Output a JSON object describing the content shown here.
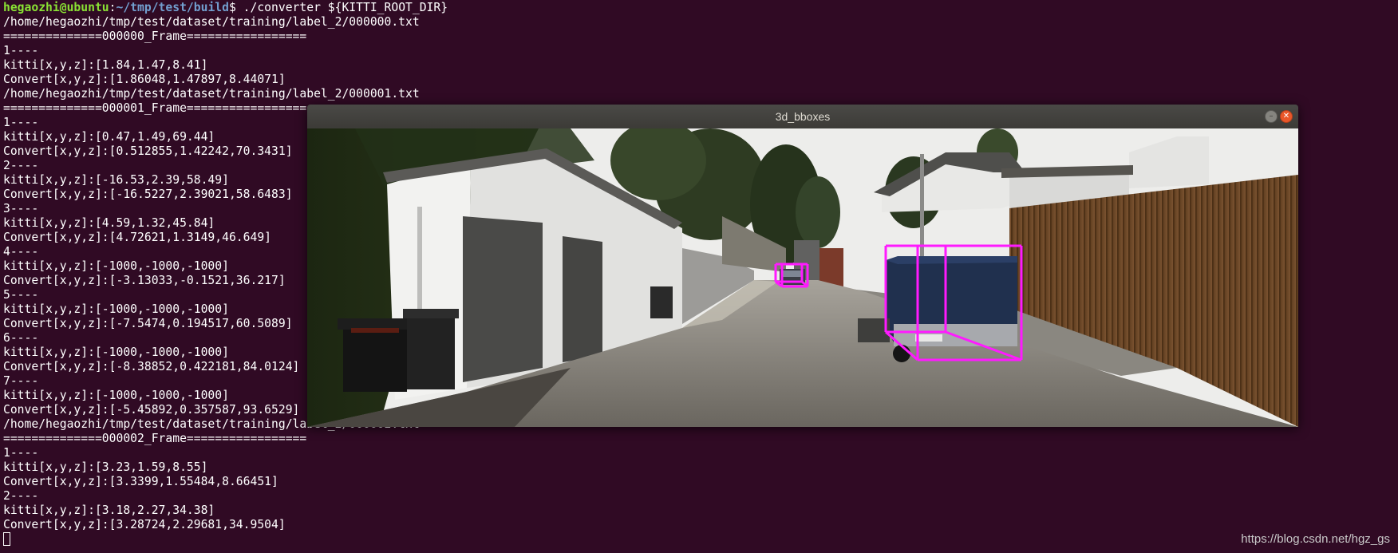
{
  "terminal": {
    "prompt_user": "hegaozhi@ubuntu",
    "prompt_path": "~/tmp/test/build",
    "prompt_cmd": "$ ./converter ${KITTI_ROOT_DIR}",
    "lines": [
      "/home/hegaozhi/tmp/test/dataset/training/label_2/000000.txt",
      "==============000000_Frame=================",
      "1----",
      "kitti[x,y,z]:[1.84,1.47,8.41]",
      "Convert[x,y,z]:[1.86048,1.47897,8.44071]",
      "/home/hegaozhi/tmp/test/dataset/training/label_2/000001.txt",
      "==============000001_Frame=================",
      "1----",
      "kitti[x,y,z]:[0.47,1.49,69.44]",
      "Convert[x,y,z]:[0.512855,1.42242,70.3431]",
      "2----",
      "kitti[x,y,z]:[-16.53,2.39,58.49]",
      "Convert[x,y,z]:[-16.5227,2.39021,58.6483]",
      "3----",
      "kitti[x,y,z]:[4.59,1.32,45.84]",
      "Convert[x,y,z]:[4.72621,1.3149,46.649]",
      "4----",
      "kitti[x,y,z]:[-1000,-1000,-1000]",
      "Convert[x,y,z]:[-3.13033,-0.1521,36.217]",
      "5----",
      "kitti[x,y,z]:[-1000,-1000,-1000]",
      "Convert[x,y,z]:[-7.5474,0.194517,60.5089]",
      "6----",
      "kitti[x,y,z]:[-1000,-1000,-1000]",
      "Convert[x,y,z]:[-8.38852,0.422181,84.0124]",
      "7----",
      "kitti[x,y,z]:[-1000,-1000,-1000]",
      "Convert[x,y,z]:[-5.45892,0.357587,93.6529]",
      "/home/hegaozhi/tmp/test/dataset/training/label_2/000002.txt",
      "==============000002_Frame=================",
      "1----",
      "kitti[x,y,z]:[3.23,1.59,8.55]",
      "Convert[x,y,z]:[3.3399,1.55484,8.66451]",
      "2----",
      "kitti[x,y,z]:[3.18,2.27,34.38]",
      "Convert[x,y,z]:[3.28724,2.29681,34.9504]"
    ]
  },
  "window": {
    "title": "3d_bboxes",
    "minimize_glyph": "–",
    "close_glyph": "✕",
    "box_color": "#ff1aff"
  },
  "watermark": "https://blog.csdn.net/hgz_gs"
}
